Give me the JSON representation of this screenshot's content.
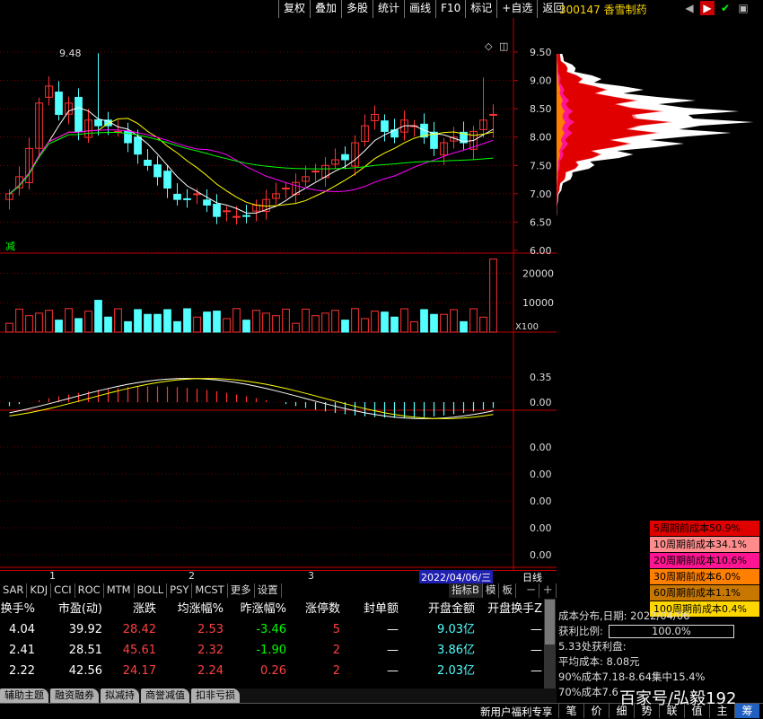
{
  "menu": [
    "复权",
    "叠加",
    "多股",
    "统计",
    "画线",
    "F10",
    "标记",
    "+自选",
    "返回"
  ],
  "stock": {
    "code": "300147",
    "name": "香雪制药"
  },
  "icons": {
    "sound": "speaker-icon",
    "flag": "flag-icon",
    "pin": "pin-icon",
    "window": "window-icon"
  },
  "main_chart": {
    "price_ticks": [
      "9.50",
      "9.00",
      "8.50",
      "8.00",
      "7.50",
      "7.00",
      "6.50",
      "6.00"
    ],
    "high_label": "9.48",
    "corner_label": "减"
  },
  "vol_chart": {
    "ticks": [
      "20000",
      "10000"
    ],
    "unit": "X100"
  },
  "macd_chart": {
    "ticks": [
      "0.35",
      "0.00"
    ]
  },
  "empty_chart": {
    "ticks": [
      "0.00",
      "0.00",
      "0.00",
      "0.00",
      "0.00"
    ]
  },
  "timebar": {
    "marks": [
      "1",
      "2",
      "3"
    ],
    "date": "2022/04/06/三",
    "period": "日线",
    "minus": "－",
    "plus": "＋"
  },
  "indicator_tabs": [
    "SAR",
    "KDJ",
    "CCI",
    "ROC",
    "MTM",
    "BOLL",
    "PSY",
    "MCST",
    "更多",
    "设置"
  ],
  "indicator_right": [
    "指标B",
    "模",
    "板"
  ],
  "table": {
    "headers": [
      "换手%",
      "市盈(动)",
      "涨跌",
      "均涨幅%",
      "昨涨幅%",
      "涨停数",
      "封单额",
      "开盘金额",
      "开盘换手Z"
    ],
    "rows": [
      [
        "4.04",
        "39.92",
        "28.42",
        "2.53",
        "-3.46",
        "5",
        "—",
        "9.03亿",
        "—"
      ],
      [
        "2.41",
        "28.51",
        "45.61",
        "2.32",
        "-1.90",
        "2",
        "—",
        "3.86亿",
        "—"
      ],
      [
        "2.22",
        "42.56",
        "24.17",
        "2.24",
        "0.26",
        "2",
        "—",
        "2.03亿",
        "—"
      ]
    ]
  },
  "bottom_tabs": [
    "辅助主题",
    "融资融券",
    "拟减持",
    "商誉减值",
    "扣非亏损"
  ],
  "chip_legend": [
    {
      "label": "5周期前成本50.9%",
      "bg": "#e00000",
      "fg": "#000"
    },
    {
      "label": "10周期前成本34.1%",
      "bg": "#ff8c8c",
      "fg": "#000"
    },
    {
      "label": "20周期前成本10.6%",
      "bg": "#ff1493",
      "fg": "#000"
    },
    {
      "label": "30周期前成本6.0%",
      "bg": "#ff7f00",
      "fg": "#000"
    },
    {
      "label": "60周期前成本1.1%",
      "bg": "#c87800",
      "fg": "#000"
    },
    {
      "label": "100周期前成本0.4%",
      "bg": "#ffd700",
      "fg": "#000"
    }
  ],
  "chip_info": {
    "date_line": "成本分布,日期: 2022/04/06",
    "profit_label": "获利比例:",
    "profit_value": "100.0%",
    "profit_line": "5.33处获利盘:",
    "avg_cost": "平均成本: 8.08元",
    "cost90": "90%成本7.18-8.64集中15.4%",
    "cost70": "70%成本7.6"
  },
  "status": {
    "text": "新用户福利专享",
    "buttons": [
      "笔",
      "价",
      "细",
      "势",
      "联",
      "值",
      "主",
      "筹"
    ]
  },
  "watermark": "百家号/弘毅192",
  "colors": {
    "up": "#ff3232",
    "down": "#54ffff",
    "ma5": "#ffffff",
    "ma10": "#ffff00",
    "ma20": "#ff00ff",
    "ma60": "#00ff00",
    "grid": "#c00000"
  }
}
